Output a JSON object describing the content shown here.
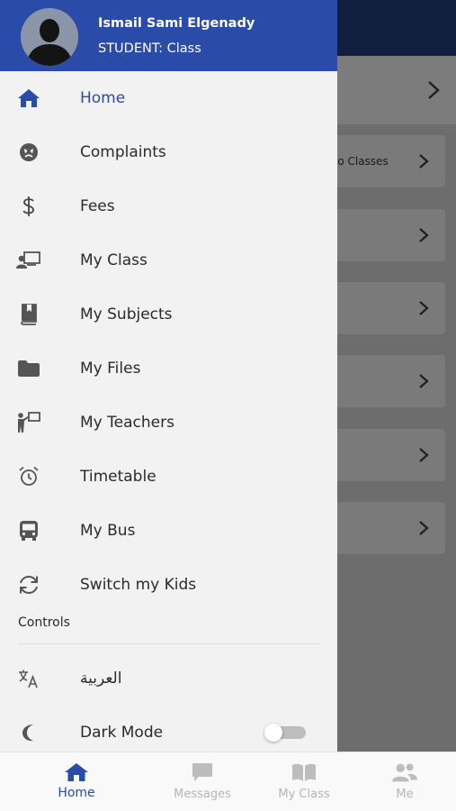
{
  "user": {
    "name": "Ismail Sami Elgenady",
    "role": "STUDENT: Class"
  },
  "menu": [
    {
      "label": "Home",
      "icon": "home-icon",
      "active": true
    },
    {
      "label": "Complaints",
      "icon": "angry-face-icon"
    },
    {
      "label": "Fees",
      "icon": "dollar-icon"
    },
    {
      "label": "My Class",
      "icon": "classroom-icon"
    },
    {
      "label": "My Subjects",
      "icon": "book-icon"
    },
    {
      "label": "My Files",
      "icon": "folder-icon"
    },
    {
      "label": "My Teachers",
      "icon": "teacher-icon"
    },
    {
      "label": "Timetable",
      "icon": "alarm-clock-icon"
    },
    {
      "label": "My Bus",
      "icon": "bus-icon"
    },
    {
      "label": "Switch my Kids",
      "icon": "sync-icon"
    }
  ],
  "controls": {
    "heading": "Controls",
    "language_label": "العربية",
    "dark_mode_label": "Dark Mode",
    "dark_mode_on": false
  },
  "background": {
    "row_text": "lo Classes"
  },
  "tabs": [
    {
      "label": "Home",
      "icon": "home-icon",
      "active": true
    },
    {
      "label": "Messages",
      "icon": "chat-icon"
    },
    {
      "label": "My Class",
      "icon": "open-book-icon"
    },
    {
      "label": "Me",
      "icon": "users-icon"
    }
  ],
  "colors": {
    "accent": "#2a4ba8",
    "drawer_bg": "#f2f2f2",
    "inactive_tab": "#b5b5b5"
  }
}
